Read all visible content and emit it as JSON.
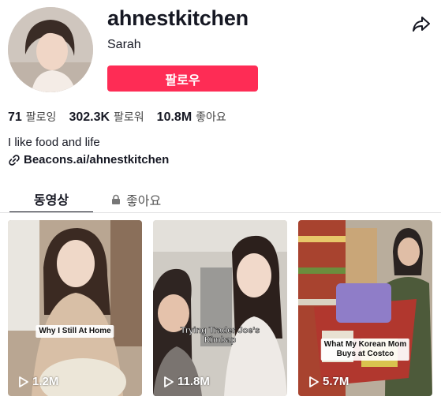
{
  "profile": {
    "username": "ahnestkitchen",
    "display_name": "Sarah",
    "follow_label": "팔로우",
    "bio": "I like food and life",
    "link": "Beacons.ai/ahnestkitchen",
    "avatar_icon": "avatar-photo"
  },
  "stats": [
    {
      "value": "71",
      "label": "팔로잉"
    },
    {
      "value": "302.3K",
      "label": "팔로워"
    },
    {
      "value": "10.8M",
      "label": "좋아요"
    }
  ],
  "tabs": {
    "videos": "동영상",
    "liked": "좋아요"
  },
  "videos": [
    {
      "caption": "Why I Still At Home",
      "views": "1.2M"
    },
    {
      "caption_line1": "Trying Trader Joe's",
      "caption_line2": "Kimbap",
      "views": "11.8M"
    },
    {
      "caption_line1": "What My Korean Mom",
      "caption_line2": "Buys at Costco",
      "views": "5.7M"
    }
  ],
  "colors": {
    "accent": "#fe2c55",
    "text": "#161823"
  }
}
